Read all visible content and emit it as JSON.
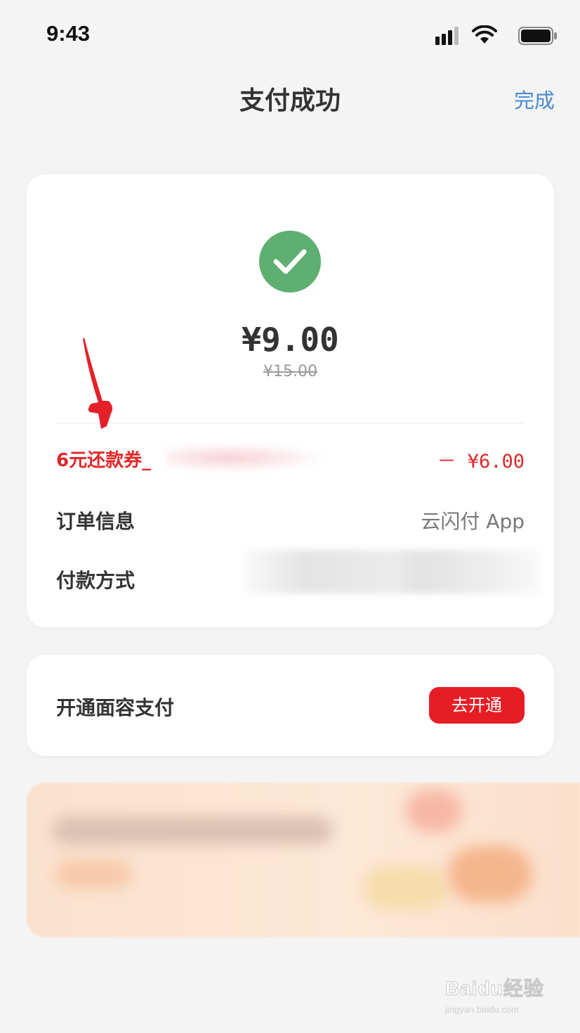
{
  "status_bar": {
    "time": "9:43",
    "icons": [
      "signal-icon",
      "wifi-icon",
      "battery-icon"
    ]
  },
  "nav": {
    "title": "支付成功",
    "done_label": "完成"
  },
  "result": {
    "status_icon": "check-circle-icon",
    "amount": "¥9.00",
    "original_amount": "¥15.00",
    "colors": {
      "success": "#5fae72"
    }
  },
  "coupon": {
    "label": "6元还款券_",
    "value": "－ ¥6.00",
    "color": "#e02828"
  },
  "order": {
    "label": "订单信息",
    "value": "云闪付 App"
  },
  "payment": {
    "label": "付款方式"
  },
  "face_pay": {
    "label": "开通面容支付",
    "button_label": "去开通",
    "button_color": "#e71d25"
  },
  "watermark": {
    "main": "Baidu经验",
    "sub": "jingyan.baidu.com"
  }
}
